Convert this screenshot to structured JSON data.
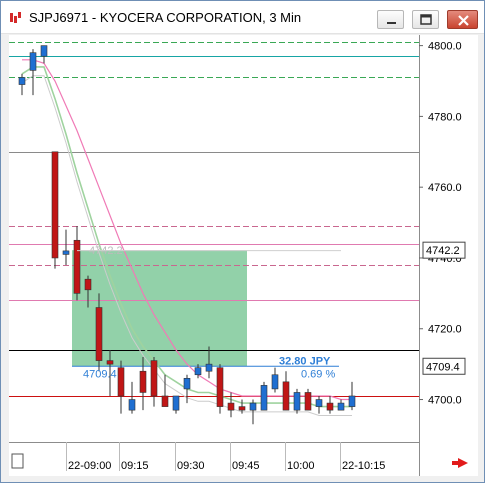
{
  "window": {
    "title": "SJPJ6971 - KYOCERA CORPORATION, 3 Min"
  },
  "colors": {
    "candle_up": "#1f6fd1",
    "candle_down": "#c01616",
    "box_fill": "#7fc99a",
    "ema_long": "#f07ab6",
    "ema_short": "#9fd39f",
    "band": "#cccccc",
    "measure_text": "#2f7fd6",
    "arrow": "#e21b1b"
  },
  "icons": {
    "app": "chart-app-icon",
    "minimize": "minimize-icon",
    "maximize": "maximize-icon",
    "close": "close-icon",
    "scroll_right": "scroll-right-arrow-icon",
    "corner": "corner-square-icon"
  },
  "y_axis": {
    "ticks": [
      "4800.0",
      "4780.0",
      "4760.0",
      "4740.0",
      "4720.0",
      "4700.0"
    ],
    "last_price_label": "4742.2",
    "current_price_label": "4709.4"
  },
  "x_axis": {
    "ticks": [
      "22-09:00",
      "09:15",
      "09:30",
      "09:45",
      "10:00",
      "22-10:15"
    ]
  },
  "annotations": {
    "measure_start_price": "4709.4",
    "measure_delta": "32.80 JPY",
    "measure_percent": "0.69 %",
    "crosshair_price": "4742.2"
  },
  "chart_data": {
    "type": "candlestick",
    "title": "SJPJ6971 - KYOCERA CORPORATION, 3 Min",
    "xlabel": "",
    "ylabel": "",
    "ylim": [
      4688,
      4803
    ],
    "candles": [
      {
        "o": 4789,
        "h": 4792,
        "l": 4786,
        "c": 4791
      },
      {
        "o": 4793,
        "h": 4799,
        "l": 4786,
        "c": 4798
      },
      {
        "o": 4797,
        "h": 4800,
        "l": 4795,
        "c": 4800
      },
      {
        "o": 4770,
        "h": 4770,
        "l": 4737,
        "c": 4740
      },
      {
        "o": 4741,
        "h": 4748,
        "l": 4738,
        "c": 4742
      },
      {
        "o": 4745,
        "h": 4749,
        "l": 4728,
        "c": 4730
      },
      {
        "o": 4734,
        "h": 4735,
        "l": 4726,
        "c": 4731
      },
      {
        "o": 4726,
        "h": 4730,
        "l": 4708,
        "c": 4711
      },
      {
        "o": 4711,
        "h": 4714,
        "l": 4701,
        "c": 4710
      },
      {
        "o": 4709,
        "h": 4711,
        "l": 4696,
        "c": 4701
      },
      {
        "o": 4697,
        "h": 4705,
        "l": 4696,
        "c": 4700
      },
      {
        "o": 4708,
        "h": 4712,
        "l": 4697,
        "c": 4702
      },
      {
        "o": 4711,
        "h": 4712,
        "l": 4698,
        "c": 4701
      },
      {
        "o": 4701,
        "h": 4707,
        "l": 4699,
        "c": 4698
      },
      {
        "o": 4697,
        "h": 4701,
        "l": 4696,
        "c": 4701
      },
      {
        "o": 4703,
        "h": 4707,
        "l": 4699,
        "c": 4706
      },
      {
        "o": 4707,
        "h": 4710,
        "l": 4706,
        "c": 4709
      },
      {
        "o": 4708,
        "h": 4715,
        "l": 4706,
        "c": 4710
      },
      {
        "o": 4709,
        "h": 4710,
        "l": 4696,
        "c": 4698
      },
      {
        "o": 4699,
        "h": 4702,
        "l": 4695,
        "c": 4697
      },
      {
        "o": 4698,
        "h": 4700,
        "l": 4696,
        "c": 4697
      },
      {
        "o": 4697,
        "h": 4700,
        "l": 4693,
        "c": 4699
      },
      {
        "o": 4697,
        "h": 4705,
        "l": 4697,
        "c": 4704
      },
      {
        "o": 4703,
        "h": 4709,
        "l": 4702,
        "c": 4707
      },
      {
        "o": 4705,
        "h": 4708,
        "l": 4697,
        "c": 4697
      },
      {
        "o": 4697,
        "h": 4703,
        "l": 4696,
        "c": 4702
      },
      {
        "o": 4702,
        "h": 4703,
        "l": 4697,
        "c": 4697
      },
      {
        "o": 4698,
        "h": 4701,
        "l": 4696,
        "c": 4700
      },
      {
        "o": 4699,
        "h": 4701,
        "l": 4696,
        "c": 4697
      },
      {
        "o": 4697,
        "h": 4700,
        "l": 4697,
        "c": 4699
      },
      {
        "o": 4698,
        "h": 4705,
        "l": 4697,
        "c": 4701
      }
    ],
    "ema_long": [
      4796,
      4796,
      4795,
      4790,
      4783,
      4776,
      4768,
      4760,
      4752,
      4744,
      4737,
      4730,
      4724,
      4719,
      4714,
      4710,
      4707,
      4705,
      4703,
      4702,
      4701,
      4701,
      4701,
      4701,
      4701,
      4701,
      4701,
      4701,
      4701,
      4700,
      4700
    ],
    "ema_short": [
      4792,
      4794,
      4794,
      4785,
      4775,
      4764,
      4754,
      4744,
      4735,
      4727,
      4720,
      4715,
      4711,
      4707,
      4705,
      4703,
      4702,
      4702,
      4701,
      4700,
      4699,
      4699,
      4699,
      4699,
      4699,
      4699,
      4699,
      4698,
      4698,
      4698,
      4698
    ],
    "horizontal_levels": [
      {
        "price": 4801,
        "style": "dashed",
        "color": "#3aa855"
      },
      {
        "price": 4797,
        "style": "solid",
        "color": "#17a5a5"
      },
      {
        "price": 4791,
        "style": "dashed",
        "color": "#3aa855"
      },
      {
        "price": 4770,
        "style": "solid",
        "color": "#8a8a8a"
      },
      {
        "price": 4749,
        "style": "dashed",
        "color": "#c9678f"
      },
      {
        "price": 4744,
        "style": "solid",
        "color": "#e07ab0"
      },
      {
        "price": 4738,
        "style": "dashed",
        "color": "#c9678f"
      },
      {
        "price": 4728,
        "style": "solid",
        "color": "#e07ab0"
      },
      {
        "price": 4714,
        "style": "solid",
        "color": "#000000"
      },
      {
        "price": 4701,
        "style": "solid",
        "color": "#cc1111"
      }
    ],
    "measure_box": {
      "from_price": 4709.4,
      "to_price": 4742.2
    }
  }
}
